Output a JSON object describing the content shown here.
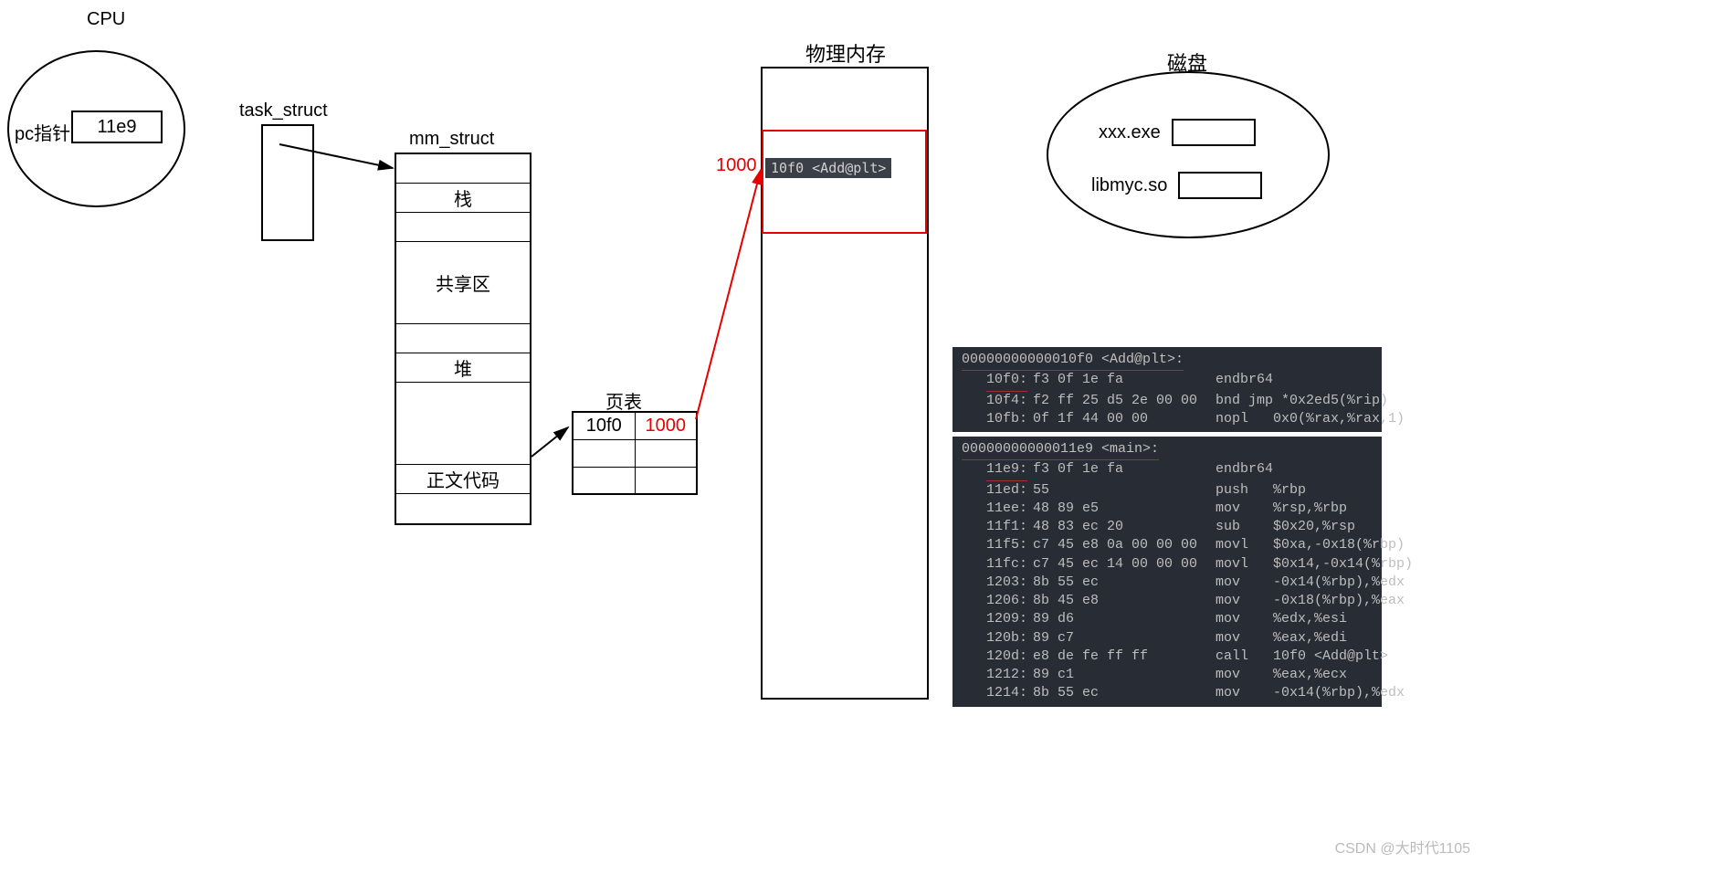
{
  "cpu": {
    "title": "CPU",
    "pc_label": "pc指针",
    "pc_value": "11e9"
  },
  "task_struct": {
    "title": "task_struct"
  },
  "mm_struct": {
    "title": "mm_struct",
    "rows": [
      "",
      "栈",
      "",
      "共享区",
      "",
      "堆",
      "",
      "正文代码",
      ""
    ]
  },
  "page_table": {
    "title": "页表",
    "vaddr": "10f0",
    "paddr": "1000"
  },
  "phys_mem": {
    "title": "物理内存",
    "addr_label": "1000",
    "entry_text": "10f0 <Add@plt>"
  },
  "disk": {
    "title": "磁盘",
    "file1": "xxx.exe",
    "file2": "libmyc.so"
  },
  "asm1": {
    "header": "00000000000010f0 <Add@plt>:",
    "rows": [
      {
        "addr": "10f0:",
        "hex": "f3 0f 1e fa",
        "instr": "endbr64"
      },
      {
        "addr": "10f4:",
        "hex": "f2 ff 25 d5 2e 00 00",
        "instr": "bnd jmp *0x2ed5(%rip)"
      },
      {
        "addr": "10fb:",
        "hex": "0f 1f 44 00 00",
        "instr": "nopl   0x0(%rax,%rax,1)"
      }
    ]
  },
  "asm2": {
    "header": "00000000000011e9 <main>:",
    "rows": [
      {
        "addr": "11e9:",
        "hex": "f3 0f 1e fa",
        "instr": "endbr64"
      },
      {
        "addr": "11ed:",
        "hex": "55",
        "instr": "push   %rbp"
      },
      {
        "addr": "11ee:",
        "hex": "48 89 e5",
        "instr": "mov    %rsp,%rbp"
      },
      {
        "addr": "11f1:",
        "hex": "48 83 ec 20",
        "instr": "sub    $0x20,%rsp"
      },
      {
        "addr": "11f5:",
        "hex": "c7 45 e8 0a 00 00 00",
        "instr": "movl   $0xa,-0x18(%rbp)"
      },
      {
        "addr": "11fc:",
        "hex": "c7 45 ec 14 00 00 00",
        "instr": "movl   $0x14,-0x14(%rbp)"
      },
      {
        "addr": "1203:",
        "hex": "8b 55 ec",
        "instr": "mov    -0x14(%rbp),%edx"
      },
      {
        "addr": "1206:",
        "hex": "8b 45 e8",
        "instr": "mov    -0x18(%rbp),%eax"
      },
      {
        "addr": "1209:",
        "hex": "89 d6",
        "instr": "mov    %edx,%esi"
      },
      {
        "addr": "120b:",
        "hex": "89 c7",
        "instr": "mov    %eax,%edi"
      },
      {
        "addr": "120d:",
        "hex": "e8 de fe ff ff",
        "instr": "call   10f0 <Add@plt>"
      },
      {
        "addr": "1212:",
        "hex": "89 c1",
        "instr": "mov    %eax,%ecx"
      },
      {
        "addr": "1214:",
        "hex": "8b 55 ec",
        "instr": "mov    -0x14(%rbp),%edx"
      }
    ]
  },
  "watermark": "CSDN @大时代1105"
}
